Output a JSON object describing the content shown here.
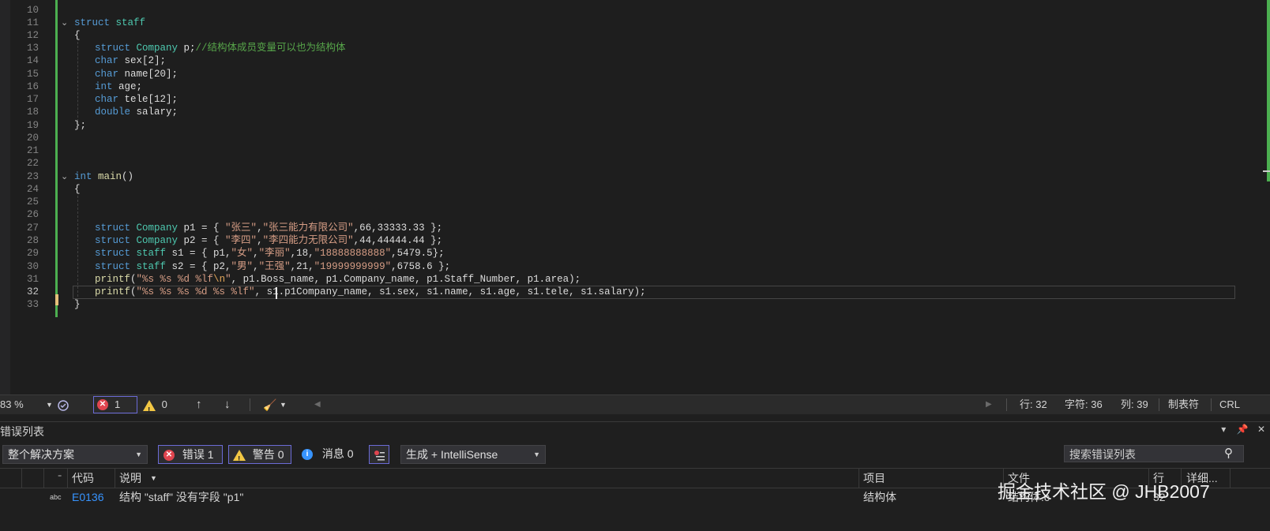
{
  "editor": {
    "line_numbers": [
      "10",
      "11",
      "12",
      "13",
      "14",
      "15",
      "16",
      "17",
      "18",
      "19",
      "20",
      "21",
      "22",
      "23",
      "24",
      "25",
      "26",
      "27",
      "28",
      "29",
      "30",
      "31",
      "32",
      "33"
    ],
    "current_line": "32",
    "code": {
      "l11": {
        "k": "struct",
        "n": " staff"
      },
      "l12": {
        "p": "{"
      },
      "l13": {
        "k": "struct",
        "t": " Company",
        "m": " p;",
        "c": "//结构体成员变量可以也为结构体"
      },
      "l14": {
        "k": "char",
        "m": " sex[2];"
      },
      "l15": {
        "k": "char",
        "m": " name[20];"
      },
      "l16": {
        "k": "int",
        "m": " age;"
      },
      "l17": {
        "k": "char",
        "m": " tele[12];"
      },
      "l18": {
        "k": "double",
        "m": " salary;"
      },
      "l19": {
        "p": "};"
      },
      "l23": {
        "k": "int",
        "f": " main",
        "p": "()"
      },
      "l24": {
        "p": "{"
      },
      "l27": {
        "k": "struct",
        "t": " Company",
        "a": " p1 = { ",
        "s1": "\"张三\"",
        "b": ",",
        "s2": "\"张三能力有限公司\"",
        "c": ",66,33333.33 };"
      },
      "l28": {
        "k": "struct",
        "t": " Company",
        "a": " p2 = { ",
        "s1": "\"李四\"",
        "b": ",",
        "s2": "\"李四能力无限公司\"",
        "c": ",44,44444.44 };"
      },
      "l29": {
        "k": "struct",
        "t": " staff",
        "a": " s1 = { p1,",
        "s1": "\"女\"",
        "b": ",",
        "s2": "\"李丽\"",
        "c": ",18,",
        "s3": "\"18888888888\"",
        "d": ",5479.5};"
      },
      "l30": {
        "k": "struct",
        "t": " staff",
        "a": " s2 = { p2,",
        "s1": "\"男\"",
        "b": ",",
        "s2": "\"王强\"",
        "c": ",21,",
        "s3": "\"19999999999\"",
        "d": ",6758.6 };"
      },
      "l31": {
        "f": "printf",
        "a": "(",
        "s1": "\"%s %s %d %lf",
        "e": "\\n",
        "s2": "\"",
        "b": ", p1.Boss_name, p1.Company_name, p1.Staff_Number, p1.area);"
      },
      "l32": {
        "f": "printf",
        "a": "(",
        "s1": "\"%s %s %s %d %s %lf\"",
        "b": ", s1.p1",
        "b2": "Company_name, s1.sex, s1.name, s1.age, s1.tele, s1.salary);"
      },
      "l33": {
        "p": "}"
      }
    }
  },
  "status": {
    "zoom": "83 %",
    "errors": "1",
    "warnings": "0",
    "line": "行: 32",
    "char": "字符: 36",
    "col": "列: 39",
    "tab": "制表符",
    "eol": "CRL"
  },
  "error_list": {
    "title": "错误列表",
    "scope": "整个解决方案",
    "errors_btn": "错误 1",
    "warnings_btn": "警告 0",
    "messages_btn": "消息 0",
    "build_filter": "生成 + IntelliSense",
    "search_placeholder": "搜索错误列表",
    "headers": {
      "code": "代码",
      "desc": "说明",
      "project": "项目",
      "file": "文件",
      "line": "行",
      "detail": "详细..."
    },
    "rows": [
      {
        "code": "E0136",
        "desc": "结构 \"staff\" 没有字段 \"p1\"",
        "project": "结构体",
        "file": "结构体.c",
        "line": "32"
      }
    ]
  },
  "watermark": "掘金技术社区 @ JHB2007",
  "colors": {
    "keyword": "#569cd6",
    "type": "#4ec9b0",
    "string": "#d69d85",
    "comment": "#57a64a",
    "accent": "#6b6bd6",
    "error": "#e0454f",
    "warning": "#f2c744"
  }
}
